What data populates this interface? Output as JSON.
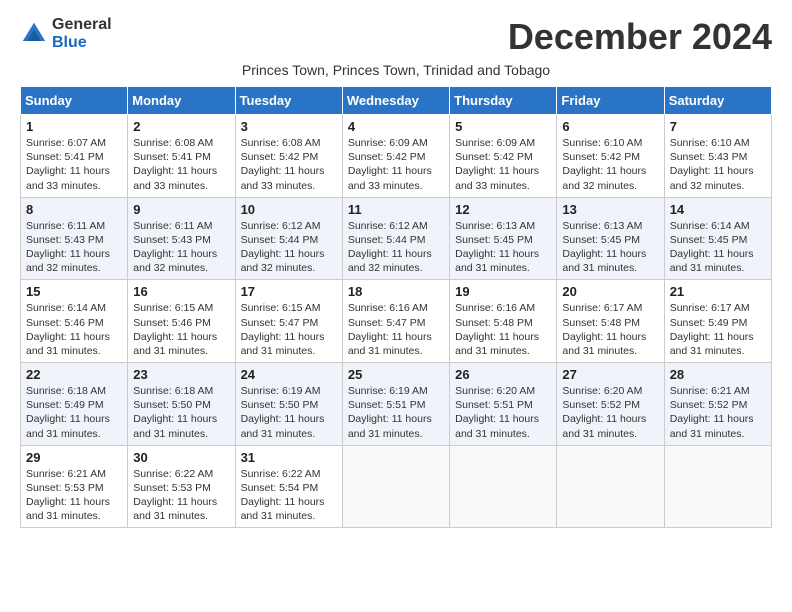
{
  "header": {
    "logo_general": "General",
    "logo_blue": "Blue",
    "month_title": "December 2024",
    "subtitle": "Princes Town, Princes Town, Trinidad and Tobago"
  },
  "columns": [
    "Sunday",
    "Monday",
    "Tuesday",
    "Wednesday",
    "Thursday",
    "Friday",
    "Saturday"
  ],
  "weeks": [
    [
      {
        "day": "1",
        "sunrise": "6:07 AM",
        "sunset": "5:41 PM",
        "daylight": "11 hours and 33 minutes."
      },
      {
        "day": "2",
        "sunrise": "6:08 AM",
        "sunset": "5:41 PM",
        "daylight": "11 hours and 33 minutes."
      },
      {
        "day": "3",
        "sunrise": "6:08 AM",
        "sunset": "5:42 PM",
        "daylight": "11 hours and 33 minutes."
      },
      {
        "day": "4",
        "sunrise": "6:09 AM",
        "sunset": "5:42 PM",
        "daylight": "11 hours and 33 minutes."
      },
      {
        "day": "5",
        "sunrise": "6:09 AM",
        "sunset": "5:42 PM",
        "daylight": "11 hours and 33 minutes."
      },
      {
        "day": "6",
        "sunrise": "6:10 AM",
        "sunset": "5:42 PM",
        "daylight": "11 hours and 32 minutes."
      },
      {
        "day": "7",
        "sunrise": "6:10 AM",
        "sunset": "5:43 PM",
        "daylight": "11 hours and 32 minutes."
      }
    ],
    [
      {
        "day": "8",
        "sunrise": "6:11 AM",
        "sunset": "5:43 PM",
        "daylight": "11 hours and 32 minutes."
      },
      {
        "day": "9",
        "sunrise": "6:11 AM",
        "sunset": "5:43 PM",
        "daylight": "11 hours and 32 minutes."
      },
      {
        "day": "10",
        "sunrise": "6:12 AM",
        "sunset": "5:44 PM",
        "daylight": "11 hours and 32 minutes."
      },
      {
        "day": "11",
        "sunrise": "6:12 AM",
        "sunset": "5:44 PM",
        "daylight": "11 hours and 32 minutes."
      },
      {
        "day": "12",
        "sunrise": "6:13 AM",
        "sunset": "5:45 PM",
        "daylight": "11 hours and 31 minutes."
      },
      {
        "day": "13",
        "sunrise": "6:13 AM",
        "sunset": "5:45 PM",
        "daylight": "11 hours and 31 minutes."
      },
      {
        "day": "14",
        "sunrise": "6:14 AM",
        "sunset": "5:45 PM",
        "daylight": "11 hours and 31 minutes."
      }
    ],
    [
      {
        "day": "15",
        "sunrise": "6:14 AM",
        "sunset": "5:46 PM",
        "daylight": "11 hours and 31 minutes."
      },
      {
        "day": "16",
        "sunrise": "6:15 AM",
        "sunset": "5:46 PM",
        "daylight": "11 hours and 31 minutes."
      },
      {
        "day": "17",
        "sunrise": "6:15 AM",
        "sunset": "5:47 PM",
        "daylight": "11 hours and 31 minutes."
      },
      {
        "day": "18",
        "sunrise": "6:16 AM",
        "sunset": "5:47 PM",
        "daylight": "11 hours and 31 minutes."
      },
      {
        "day": "19",
        "sunrise": "6:16 AM",
        "sunset": "5:48 PM",
        "daylight": "11 hours and 31 minutes."
      },
      {
        "day": "20",
        "sunrise": "6:17 AM",
        "sunset": "5:48 PM",
        "daylight": "11 hours and 31 minutes."
      },
      {
        "day": "21",
        "sunrise": "6:17 AM",
        "sunset": "5:49 PM",
        "daylight": "11 hours and 31 minutes."
      }
    ],
    [
      {
        "day": "22",
        "sunrise": "6:18 AM",
        "sunset": "5:49 PM",
        "daylight": "11 hours and 31 minutes."
      },
      {
        "day": "23",
        "sunrise": "6:18 AM",
        "sunset": "5:50 PM",
        "daylight": "11 hours and 31 minutes."
      },
      {
        "day": "24",
        "sunrise": "6:19 AM",
        "sunset": "5:50 PM",
        "daylight": "11 hours and 31 minutes."
      },
      {
        "day": "25",
        "sunrise": "6:19 AM",
        "sunset": "5:51 PM",
        "daylight": "11 hours and 31 minutes."
      },
      {
        "day": "26",
        "sunrise": "6:20 AM",
        "sunset": "5:51 PM",
        "daylight": "11 hours and 31 minutes."
      },
      {
        "day": "27",
        "sunrise": "6:20 AM",
        "sunset": "5:52 PM",
        "daylight": "11 hours and 31 minutes."
      },
      {
        "day": "28",
        "sunrise": "6:21 AM",
        "sunset": "5:52 PM",
        "daylight": "11 hours and 31 minutes."
      }
    ],
    [
      {
        "day": "29",
        "sunrise": "6:21 AM",
        "sunset": "5:53 PM",
        "daylight": "11 hours and 31 minutes."
      },
      {
        "day": "30",
        "sunrise": "6:22 AM",
        "sunset": "5:53 PM",
        "daylight": "11 hours and 31 minutes."
      },
      {
        "day": "31",
        "sunrise": "6:22 AM",
        "sunset": "5:54 PM",
        "daylight": "11 hours and 31 minutes."
      },
      null,
      null,
      null,
      null
    ]
  ]
}
